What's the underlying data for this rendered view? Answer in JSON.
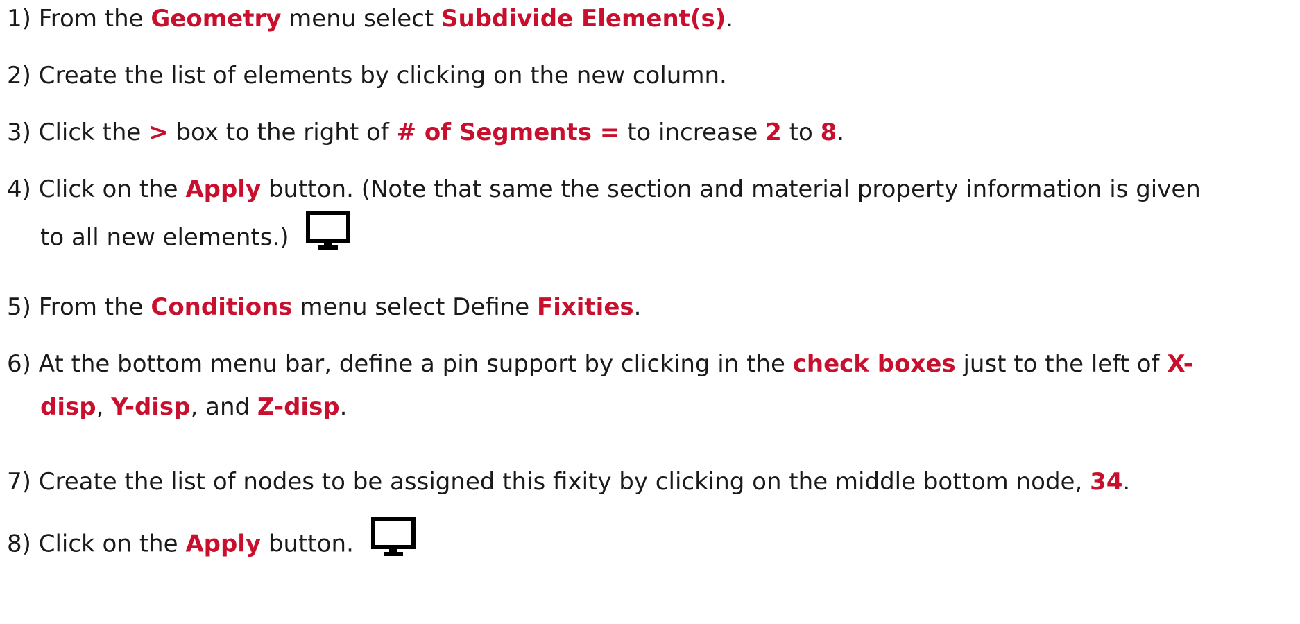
{
  "steps": [
    {
      "n": "1)",
      "parts": [
        {
          "t": "From the ",
          "h": false
        },
        {
          "t": "Geometry",
          "h": true
        },
        {
          "t": " menu select ",
          "h": false
        },
        {
          "t": "Subdivide Element(s)",
          "h": true
        },
        {
          "t": ".",
          "h": false
        }
      ]
    },
    {
      "n": "2)",
      "parts": [
        {
          "t": "Create the list of elements by clicking on the new column.",
          "h": false
        }
      ]
    },
    {
      "n": "3)",
      "parts": [
        {
          "t": "Click the ",
          "h": false
        },
        {
          "t": ">",
          "h": true
        },
        {
          "t": " box to the right of ",
          "h": false
        },
        {
          "t": "# of Segments =",
          "h": true
        },
        {
          "t": " to increase ",
          "h": false
        },
        {
          "t": "2",
          "h": true
        },
        {
          "t": " to ",
          "h": false
        },
        {
          "t": "8",
          "h": true
        },
        {
          "t": ".",
          "h": false
        }
      ]
    },
    {
      "n": "4)",
      "line1": [
        {
          "t": "Click on the ",
          "h": false
        },
        {
          "t": "Apply",
          "h": true
        },
        {
          "t": " button. (Note that same the section and material property information is given",
          "h": false
        }
      ],
      "line2": [
        {
          "t": "to all new elements.)",
          "h": false
        }
      ],
      "icon": "monitor-icon"
    },
    {
      "n": "5)",
      "parts": [
        {
          "t": "From the ",
          "h": false
        },
        {
          "t": "Conditions",
          "h": true
        },
        {
          "t": " menu select Define ",
          "h": false
        },
        {
          "t": "Fixities",
          "h": true
        },
        {
          "t": ".",
          "h": false
        }
      ]
    },
    {
      "n": "6)",
      "line1": [
        {
          "t": "At the bottom menu bar, define a pin support by clicking in the ",
          "h": false
        },
        {
          "t": "check boxes",
          "h": true
        },
        {
          "t": " just to the left of ",
          "h": false
        },
        {
          "t": "X-",
          "h": true
        }
      ],
      "line2": [
        {
          "t": "disp",
          "h": true
        },
        {
          "t": ", ",
          "h": false
        },
        {
          "t": "Y-disp",
          "h": true
        },
        {
          "t": ", and ",
          "h": false
        },
        {
          "t": "Z-disp",
          "h": true
        },
        {
          "t": ".",
          "h": false
        }
      ]
    },
    {
      "n": "7)",
      "parts": [
        {
          "t": "Create the list of nodes to be assigned this fixity by clicking on the middle bottom node, ",
          "h": false
        },
        {
          "t": "34",
          "h": true
        },
        {
          "t": ".",
          "h": false
        }
      ]
    },
    {
      "n": "8)",
      "parts": [
        {
          "t": "Click on the ",
          "h": false
        },
        {
          "t": "Apply",
          "h": true
        },
        {
          "t": " button.",
          "h": false
        }
      ],
      "icon": "monitor-icon"
    }
  ],
  "colors": {
    "text": "#1a1a1a",
    "highlight": "#c8102e",
    "icon": "#000000"
  }
}
